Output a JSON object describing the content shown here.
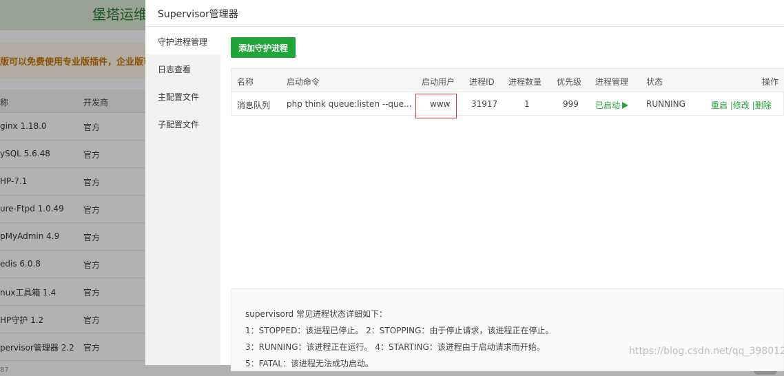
{
  "background": {
    "panel_title": "堡塔运维",
    "notice": "版可以免费使用专业版插件，企业版可",
    "table_headers": {
      "name": "称",
      "developer": "开发商"
    },
    "software_rows": [
      {
        "name": "ginx 1.18.0",
        "developer": "官方"
      },
      {
        "name": "ySQL 5.6.48",
        "developer": "官方"
      },
      {
        "name": "HP-7.1",
        "developer": "官方"
      },
      {
        "name": "ure-Ftpd 1.0.49",
        "developer": "官方"
      },
      {
        "name": "pMyAdmin 4.9",
        "developer": "官方"
      },
      {
        "name": "edis 6.0.8",
        "developer": "官方"
      },
      {
        "name": "nux工具箱 1.4",
        "developer": "官方"
      },
      {
        "name": "HP守护 1.2",
        "developer": "官方"
      },
      {
        "name": "pervisor管理器 2.2",
        "developer": "官方"
      }
    ],
    "bottom_text": "87"
  },
  "modal": {
    "title": "Supervisor管理器",
    "sidebar": [
      {
        "label": "守护进程管理",
        "active": true
      },
      {
        "label": "日志查看",
        "active": false
      },
      {
        "label": "主配置文件",
        "active": false
      },
      {
        "label": "子配置文件",
        "active": false
      }
    ],
    "add_button": "添加守护进程",
    "table": {
      "headers": {
        "name": "名称",
        "command": "启动命令",
        "user": "启动用户",
        "pid": "进程ID",
        "count": "进程数量",
        "priority": "优先级",
        "manage": "进程管理",
        "status": "状态",
        "actions": "操作"
      },
      "rows": [
        {
          "name": "消息队列",
          "command": "php think queue:listen --que...",
          "user": "www",
          "pid": "31917",
          "count": "1",
          "priority": "999",
          "manage": "已启动",
          "status": "RUNNING",
          "action_restart": "重启",
          "action_edit": "修改",
          "action_delete": "删除"
        }
      ]
    },
    "status_help": {
      "heading": "supervisord 常见进程状态详细如下：",
      "line1": "1：STOPPED：该进程已停止。     2：STOPPING：由于停止请求，该进程正在停止。",
      "line2": "3：RUNNING：该进程正在运行。  4：STARTING：该进程由于启动请求而开始。",
      "line3": "5：FATAL：该进程无法成功启动。"
    }
  },
  "watermark": "https://blog.csdn.net/qq_398012",
  "colors": {
    "accent_green": "#20a53a",
    "highlight_red": "#e0353b"
  }
}
